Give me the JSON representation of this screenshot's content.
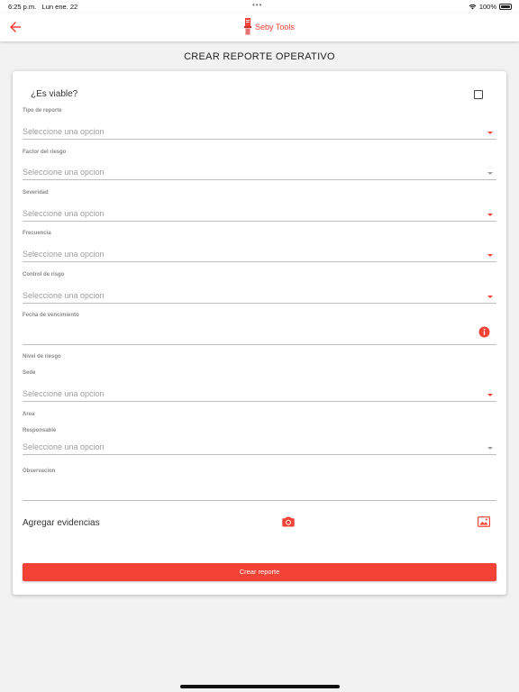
{
  "status_bar": {
    "time": "6:25 p.m.",
    "date": "Lun ene. 22",
    "dots": "•••",
    "battery": "100%"
  },
  "header": {
    "brand_name": "Seby Tools",
    "back_icon": "arrow-left-icon",
    "logo_icon": "seby-tools-logo"
  },
  "page": {
    "title": "CREAR REPORTE OPERATIVO"
  },
  "form": {
    "viable_label": "¿Es viable?",
    "viable_checked": false,
    "tipo_reporte": {
      "label": "Tipo de reporte",
      "value": "Seleccione una opcion"
    },
    "factor_riesgo": {
      "label": "Factor del riesgo",
      "value": "Seleccione una opcion"
    },
    "severidad": {
      "label": "Severidad",
      "value": "Seleccione una opcion"
    },
    "frecuencia": {
      "label": "Frecuencia",
      "value": "Seleccione una opcion"
    },
    "control_riesgo": {
      "label": "Control de risgo",
      "value": "Seleccione una opcion"
    },
    "fecha_vencimiento": {
      "label": "Fecha de vencimiento",
      "value": ""
    },
    "nivel_riesgo": {
      "label": "Nivel de riesgo"
    },
    "sede": {
      "label": "Sede",
      "value": "Seleccione una opcion"
    },
    "area": {
      "label": "Area"
    },
    "responsable": {
      "label": "Responsable",
      "value": "Seleccione una opcion"
    },
    "observacion": {
      "label": "Observacion",
      "value": ""
    },
    "evidencias_label": "Agregar evidencias",
    "submit_label": "Crear reporte"
  },
  "colors": {
    "accent": "#f44336",
    "placeholder": "#9e9e9e",
    "background": "#f2f2f2"
  }
}
